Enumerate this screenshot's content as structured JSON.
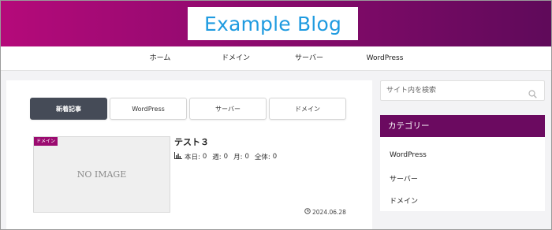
{
  "header": {
    "logo": "Example Blog"
  },
  "nav": {
    "items": [
      "ホーム",
      "ドメイン",
      "サーバー",
      "WordPress"
    ]
  },
  "tabs": [
    "新着記事",
    "WordPress",
    "サーバー",
    "ドメイン"
  ],
  "post": {
    "category": "ドメイン",
    "thumbnail_text": "NO IMAGE",
    "title": "テスト３",
    "stats": {
      "today_label": "本日:",
      "today": "0",
      "week_label": "週:",
      "week": "0",
      "month_label": "月:",
      "month": "0",
      "total_label": "全体:",
      "total": "0"
    },
    "date": "2024.06.28"
  },
  "sidebar": {
    "search_placeholder": "サイト内を検索",
    "categories_title": "カテゴリー",
    "categories": [
      "WordPress",
      "サーバー",
      "ドメイン"
    ]
  },
  "colors": {
    "header_gradient_start": "#b50a7a",
    "header_gradient_end": "#5f0a5a",
    "logo_text": "#1f9be0",
    "active_tab": "#454b57",
    "category_header": "#6b0a60",
    "category_badge": "#9b0b70"
  },
  "icons": {
    "stats": "bar-chart-icon",
    "date": "clock-icon",
    "search": "search-icon"
  }
}
